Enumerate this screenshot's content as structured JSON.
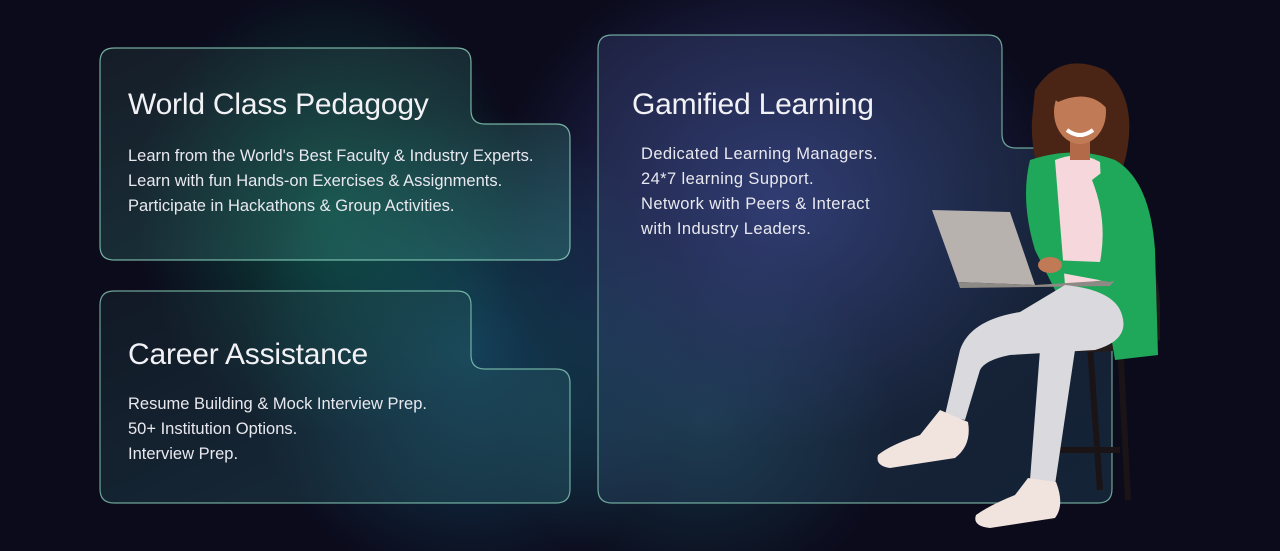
{
  "cards": [
    {
      "title": "World Class Pedagogy",
      "lines": [
        "Learn from the World's Best Faculty & Industry Experts.",
        "Learn with fun Hands-on Exercises & Assignments.",
        "Participate in Hackathons & Group Activities."
      ]
    },
    {
      "title": "Career Assistance",
      "lines": [
        "Resume Building & Mock Interview Prep.",
        "50+ Institution Options.",
        "Interview Prep."
      ]
    },
    {
      "title": "Gamified Learning",
      "lines": [
        "Dedicated Learning Managers.",
        "24*7 learning Support.",
        "Network with Peers & Interact",
        "with Industry Leaders."
      ]
    }
  ],
  "colors": {
    "background": "#0b0b1c",
    "card_border": "#9fe3c8",
    "jacket": "#1fa85a",
    "top": "#f6d8dc",
    "pants": "#d9d9de"
  },
  "image": "woman-with-laptop"
}
